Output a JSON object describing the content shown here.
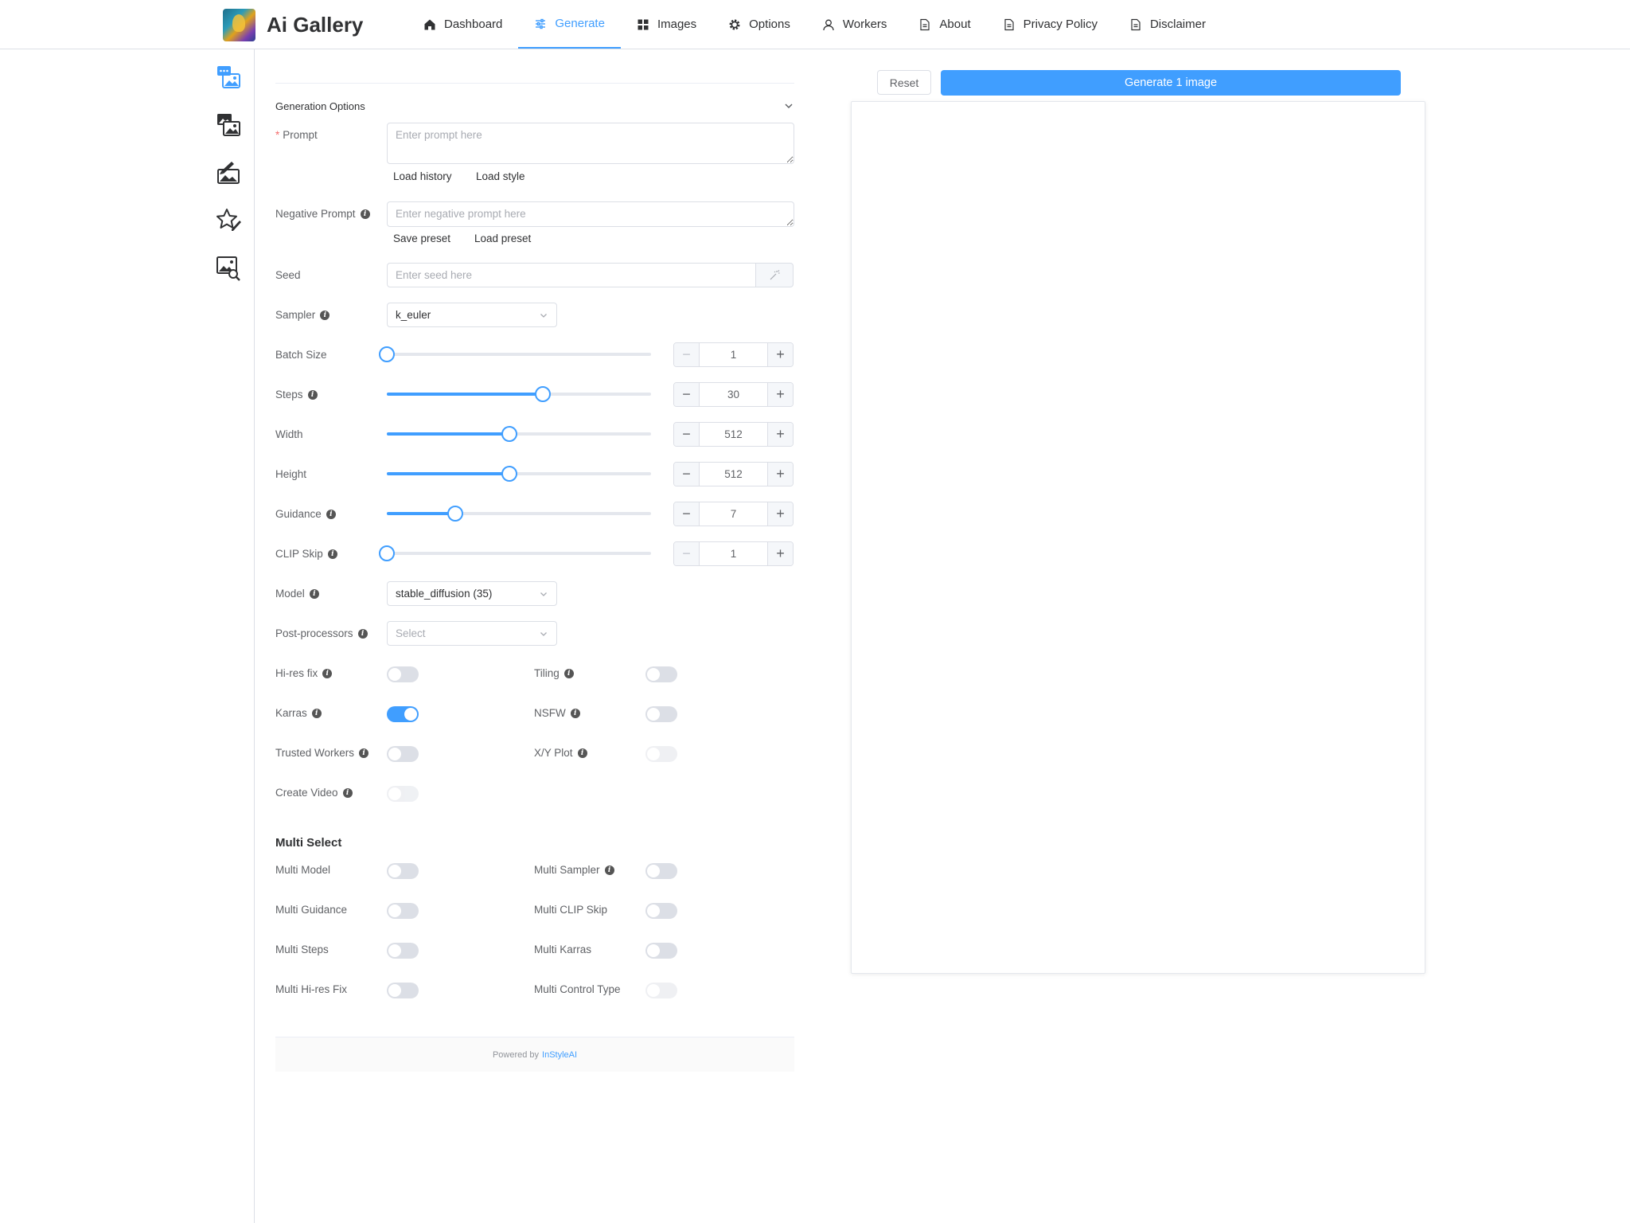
{
  "app": {
    "title": "Ai Gallery"
  },
  "nav": [
    {
      "label": "Dashboard",
      "icon": "home-icon"
    },
    {
      "label": "Generate",
      "icon": "sliders-icon",
      "active": true
    },
    {
      "label": "Images",
      "icon": "grid-icon"
    },
    {
      "label": "Options",
      "icon": "gear-icon"
    },
    {
      "label": "Workers",
      "icon": "user-icon"
    },
    {
      "label": "About",
      "icon": "document-icon"
    },
    {
      "label": "Privacy Policy",
      "icon": "document-icon"
    },
    {
      "label": "Disclaimer",
      "icon": "document-icon"
    }
  ],
  "sidebar_icons": [
    "text-to-image-icon",
    "image-to-image-icon",
    "inpainting-icon",
    "rate-icon",
    "interrogate-icon"
  ],
  "colors": {
    "accent": "#409eff",
    "border": "#dcdfe6",
    "required": "#f56c6c"
  },
  "form": {
    "section_title": "Generation Options",
    "prompt": {
      "required_mark": "*",
      "label": "Prompt",
      "placeholder": "Enter prompt here",
      "value": ""
    },
    "prompt_actions": {
      "load_history": "Load history",
      "load_style": "Load style"
    },
    "negative_prompt": {
      "label": "Negative Prompt",
      "placeholder": "Enter negative prompt here",
      "value": ""
    },
    "negative_actions": {
      "save_preset": "Save preset",
      "load_preset": "Load preset"
    },
    "seed": {
      "label": "Seed",
      "placeholder": "Enter seed here"
    },
    "sampler": {
      "label": "Sampler",
      "value": "k_euler"
    },
    "sliders": [
      {
        "key": "batch",
        "label": "Batch Size",
        "value": "1",
        "fraction": 0.0,
        "minus_disabled": true,
        "info": false
      },
      {
        "key": "steps",
        "label": "Steps",
        "value": "30",
        "fraction": 0.59,
        "minus_disabled": false,
        "info": true
      },
      {
        "key": "width",
        "label": "Width",
        "value": "512",
        "fraction": 0.465,
        "minus_disabled": false,
        "info": false
      },
      {
        "key": "height",
        "label": "Height",
        "value": "512",
        "fraction": 0.465,
        "minus_disabled": false,
        "info": false
      },
      {
        "key": "guidance",
        "label": "Guidance",
        "value": "7",
        "fraction": 0.26,
        "minus_disabled": false,
        "info": true
      },
      {
        "key": "clip",
        "label": "CLIP Skip",
        "value": "1",
        "fraction": 0.0,
        "minus_disabled": true,
        "info": true
      }
    ],
    "model": {
      "label": "Model",
      "value": "stable_diffusion (35)"
    },
    "post_processors": {
      "label": "Post-processors",
      "placeholder": "Select"
    },
    "toggles": {
      "hires": {
        "label": "Hi-res fix",
        "on": false
      },
      "tiling": {
        "label": "Tiling",
        "on": false
      },
      "karras": {
        "label": "Karras",
        "on": true
      },
      "nsfw": {
        "label": "NSFW",
        "on": false
      },
      "trusted": {
        "label": "Trusted Workers",
        "on": false
      },
      "xy_plot": {
        "label": "X/Y Plot",
        "on": false,
        "disabled": true
      },
      "video": {
        "label": "Create Video",
        "on": false,
        "disabled": true
      }
    },
    "multi_select": {
      "title": "Multi Select",
      "items": {
        "model": {
          "label": "Multi Model",
          "on": false
        },
        "sampler": {
          "label": "Multi Sampler",
          "on": false
        },
        "guidance": {
          "label": "Multi Guidance",
          "on": false
        },
        "clip": {
          "label": "Multi CLIP Skip",
          "on": false
        },
        "steps": {
          "label": "Multi Steps",
          "on": false
        },
        "karras": {
          "label": "Multi Karras",
          "on": false
        },
        "hires": {
          "label": "Multi Hi-res Fix",
          "on": false
        },
        "control": {
          "label": "Multi Control Type",
          "on": false,
          "disabled": true
        }
      }
    },
    "footer": {
      "prefix": "Powered by",
      "link": "InStyleAI"
    }
  },
  "actions": {
    "reset": "Reset",
    "generate": "Generate 1 image"
  }
}
